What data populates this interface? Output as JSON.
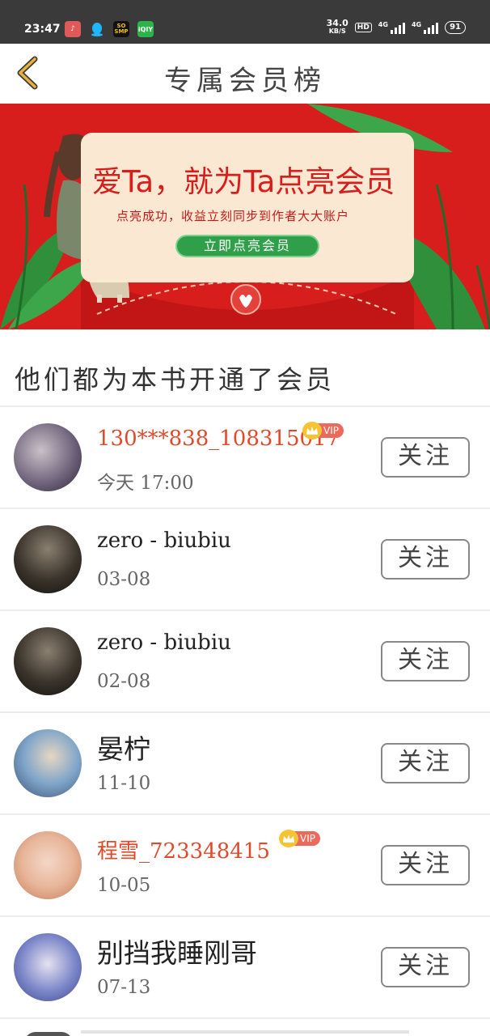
{
  "status_bar": {
    "time": "23:47",
    "apps": [
      {
        "name": "music-app-icon",
        "glyph": "♪"
      },
      {
        "name": "qq-app-icon",
        "glyph": "●"
      },
      {
        "name": "soul-app-icon",
        "glyph": "SO\nSMP"
      },
      {
        "name": "iqiyi-app-icon",
        "glyph": "iQIY"
      }
    ],
    "net_speed": "34.0",
    "net_unit": "KB/S",
    "hd": "HD",
    "sig1_label": "4G",
    "sig2_label": "4G",
    "battery": "91"
  },
  "header": {
    "title": "专属会员榜"
  },
  "banner": {
    "headline": "爱Ta，就为Ta点亮会员",
    "subtitle": "点亮成功，收益立刻同步到作者大大账户",
    "cta": "立即点亮会员"
  },
  "section": {
    "title": "他们都为本书开通了会员"
  },
  "members": [
    {
      "name": "130***838_108315017",
      "date": "今天 17:00",
      "vip": true,
      "vip_label": "VIP",
      "follow": "关注",
      "avatar_colors": [
        "#6b5f78",
        "#c9c1c8",
        "#2b2430"
      ]
    },
    {
      "name": "zero - biubiu",
      "date": "03-08",
      "vip": false,
      "follow": "关注",
      "avatar_colors": [
        "#2b2622",
        "#6e6558",
        "#14110e"
      ]
    },
    {
      "name": "zero - biubiu",
      "date": "02-08",
      "vip": false,
      "follow": "关注",
      "avatar_colors": [
        "#2b2622",
        "#6e6558",
        "#14110e"
      ]
    },
    {
      "name": "晏柠",
      "date": "11-10",
      "vip": false,
      "follow": "关注",
      "avatar_colors": [
        "#7fa5c9",
        "#e6d7c2",
        "#3a5070"
      ]
    },
    {
      "name": "程雪_723348415",
      "date": "10-05",
      "vip": true,
      "vip_label": "VIP",
      "follow": "关注",
      "avatar_colors": [
        "#e8b69a",
        "#f4d7c8",
        "#c47a58"
      ]
    },
    {
      "name": "别挡我睡刚哥",
      "date": "07-13",
      "vip": false,
      "follow": "关注",
      "avatar_colors": [
        "#7b86c9",
        "#e6e2ef",
        "#3d4488"
      ]
    }
  ],
  "colors": {
    "vip_name": "#e04a2b",
    "banner_red": "#d81d1d",
    "cta_green": "#2f9f4a",
    "back_icon": "#e6b23a"
  }
}
